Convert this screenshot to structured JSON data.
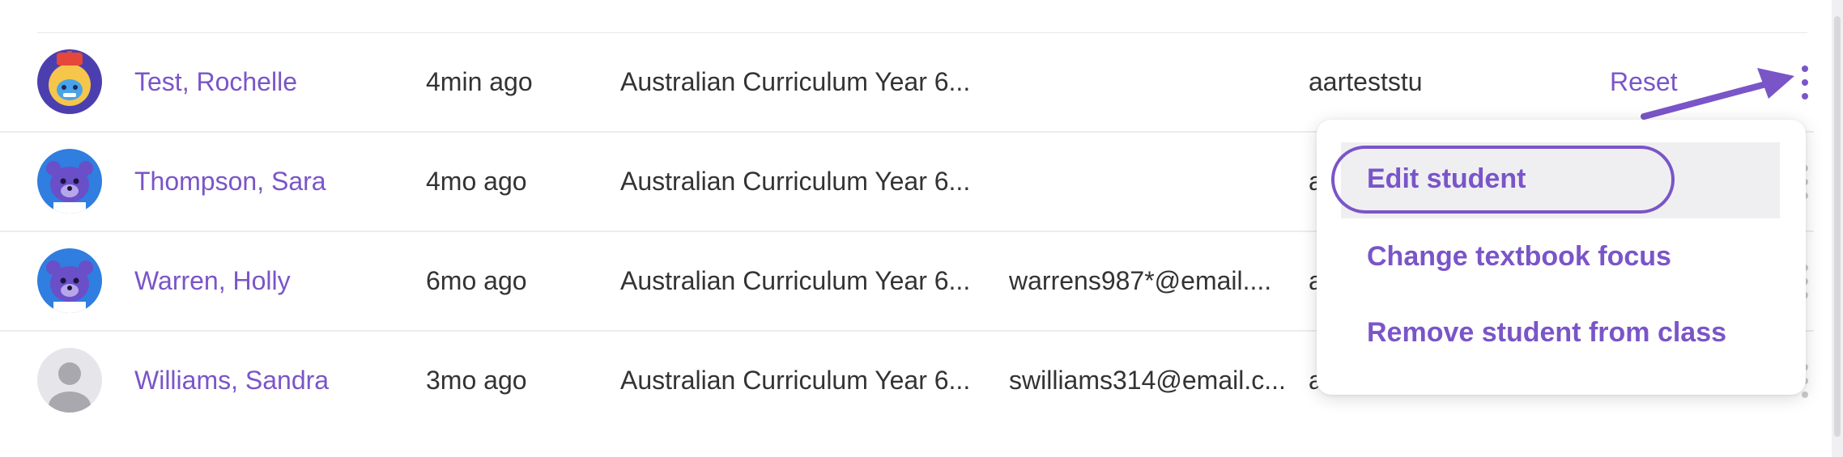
{
  "students": [
    {
      "name": "Test, Rochelle",
      "last_active": "4min ago",
      "curriculum": "Australian Curriculum Year 6...",
      "email": "",
      "username": "aarteststu",
      "action": "Reset",
      "avatar": "robot-avatar"
    },
    {
      "name": "Thompson, Sara",
      "last_active": "4mo ago",
      "curriculum": "Australian Curriculum Year 6...",
      "email": "",
      "username": "a",
      "action": "",
      "avatar": "bear-avatar"
    },
    {
      "name": "Warren, Holly",
      "last_active": "6mo ago",
      "curriculum": "Australian Curriculum Year 6...",
      "email": "warrens987*@email....",
      "username": "a",
      "action": "",
      "avatar": "bear-avatar"
    },
    {
      "name": "Williams, Sandra",
      "last_active": "3mo ago",
      "curriculum": "Australian Curriculum Year 6...",
      "email": "swilliams314@email.c...",
      "username": "a",
      "action": "",
      "avatar": "default-user-avatar"
    }
  ],
  "menu": {
    "items": [
      {
        "label": "Edit student"
      },
      {
        "label": "Change textbook focus"
      },
      {
        "label": "Remove student from class"
      }
    ]
  },
  "colors": {
    "accent": "#7a55c8",
    "highlight": "#efeff2",
    "divider": "#ececf0"
  }
}
